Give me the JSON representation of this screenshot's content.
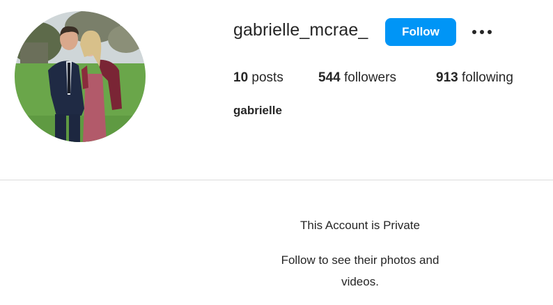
{
  "profile": {
    "username": "gabrielle_mcrae_",
    "full_name": "gabrielle",
    "avatar_icon": "profile-photo-couple"
  },
  "actions": {
    "follow_label": "Follow",
    "more_icon": "more-options-icon"
  },
  "stats": {
    "posts_count": "10",
    "posts_label": " posts",
    "followers_count": "544",
    "followers_label": " followers",
    "following_count": "913",
    "following_label": " following"
  },
  "private_notice": {
    "title": "This Account is Private",
    "subtitle": "Follow to see their photos and videos."
  },
  "colors": {
    "accent": "#0095f6",
    "divider": "#dbdbdb",
    "text": "#262626"
  }
}
